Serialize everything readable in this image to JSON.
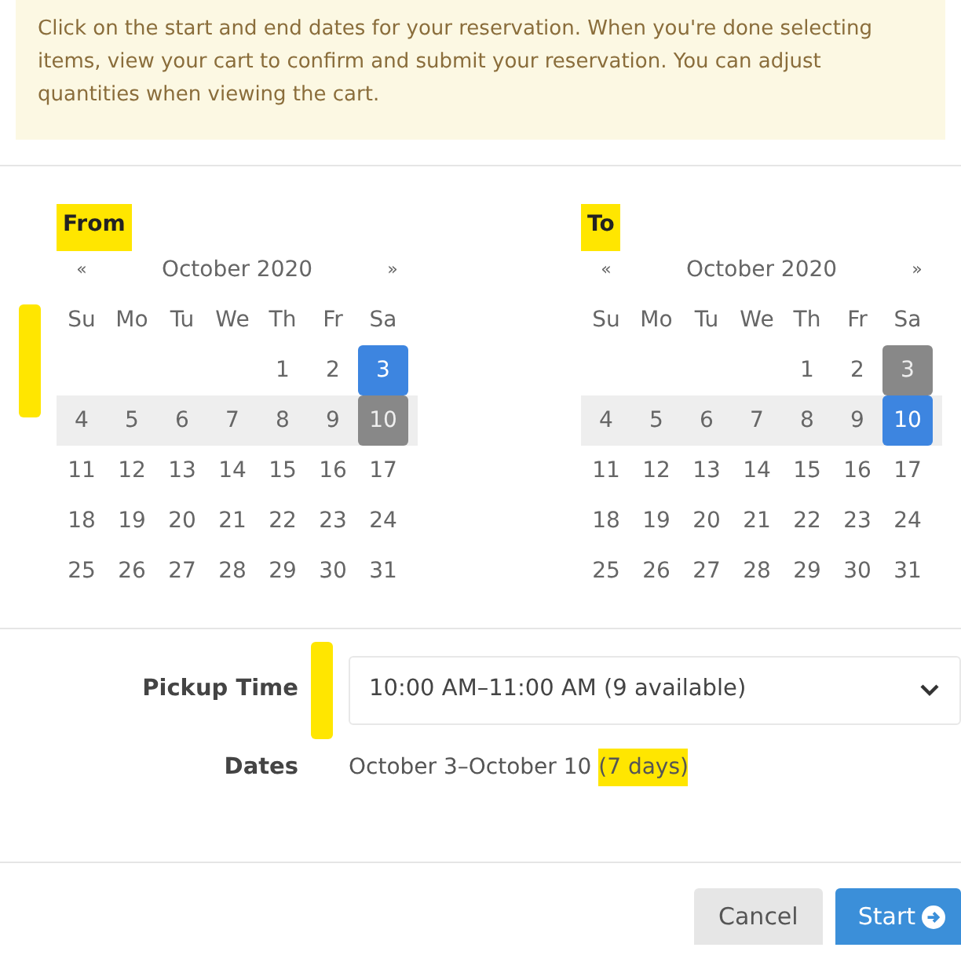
{
  "notice": "Click on the start and end dates for your reservation. When you're done selecting items, view your cart to confirm and submit your reservation. You can adjust quantities when viewing the cart.",
  "calendars": [
    {
      "label": "From",
      "highlighted": true,
      "prev": "«",
      "month": "October 2020",
      "next": "»",
      "weekdays": [
        "Su",
        "Mo",
        "Tu",
        "We",
        "Th",
        "Fr",
        "Sa"
      ],
      "weeks": [
        [
          {
            "kind": "blank"
          },
          {
            "kind": "blank"
          },
          {
            "kind": "blank"
          },
          {
            "kind": "blank"
          },
          {
            "day": "1",
            "kind": "normal"
          },
          {
            "day": "2",
            "kind": "normal"
          },
          {
            "day": "3",
            "kind": "selected"
          }
        ],
        [
          {
            "day": "4",
            "kind": "range"
          },
          {
            "day": "5",
            "kind": "range"
          },
          {
            "day": "6",
            "kind": "range"
          },
          {
            "day": "7",
            "kind": "range"
          },
          {
            "day": "8",
            "kind": "range"
          },
          {
            "day": "9",
            "kind": "range"
          },
          {
            "day": "10",
            "kind": "endpoint"
          }
        ],
        [
          {
            "day": "11",
            "kind": "normal"
          },
          {
            "day": "12",
            "kind": "normal"
          },
          {
            "day": "13",
            "kind": "normal"
          },
          {
            "day": "14",
            "kind": "normal"
          },
          {
            "day": "15",
            "kind": "normal"
          },
          {
            "day": "16",
            "kind": "normal"
          },
          {
            "day": "17",
            "kind": "normal"
          }
        ],
        [
          {
            "day": "18",
            "kind": "normal"
          },
          {
            "day": "19",
            "kind": "normal"
          },
          {
            "day": "20",
            "kind": "normal"
          },
          {
            "day": "21",
            "kind": "normal"
          },
          {
            "day": "22",
            "kind": "normal"
          },
          {
            "day": "23",
            "kind": "normal"
          },
          {
            "day": "24",
            "kind": "normal"
          }
        ],
        [
          {
            "day": "25",
            "kind": "normal"
          },
          {
            "day": "26",
            "kind": "normal"
          },
          {
            "day": "27",
            "kind": "normal"
          },
          {
            "day": "28",
            "kind": "normal"
          },
          {
            "day": "29",
            "kind": "normal"
          },
          {
            "day": "30",
            "kind": "normal"
          },
          {
            "day": "31",
            "kind": "normal"
          }
        ]
      ]
    },
    {
      "label": "To",
      "highlighted": true,
      "prev": "«",
      "month": "October 2020",
      "next": "»",
      "weekdays": [
        "Su",
        "Mo",
        "Tu",
        "We",
        "Th",
        "Fr",
        "Sa"
      ],
      "weeks": [
        [
          {
            "kind": "blank"
          },
          {
            "kind": "blank"
          },
          {
            "kind": "blank"
          },
          {
            "kind": "blank"
          },
          {
            "day": "1",
            "kind": "normal"
          },
          {
            "day": "2",
            "kind": "normal"
          },
          {
            "day": "3",
            "kind": "endpoint"
          }
        ],
        [
          {
            "day": "4",
            "kind": "range"
          },
          {
            "day": "5",
            "kind": "range"
          },
          {
            "day": "6",
            "kind": "range"
          },
          {
            "day": "7",
            "kind": "range"
          },
          {
            "day": "8",
            "kind": "range"
          },
          {
            "day": "9",
            "kind": "range"
          },
          {
            "day": "10",
            "kind": "selected"
          }
        ],
        [
          {
            "day": "11",
            "kind": "normal"
          },
          {
            "day": "12",
            "kind": "normal"
          },
          {
            "day": "13",
            "kind": "normal"
          },
          {
            "day": "14",
            "kind": "normal"
          },
          {
            "day": "15",
            "kind": "normal"
          },
          {
            "day": "16",
            "kind": "normal"
          },
          {
            "day": "17",
            "kind": "normal"
          }
        ],
        [
          {
            "day": "18",
            "kind": "normal"
          },
          {
            "day": "19",
            "kind": "normal"
          },
          {
            "day": "20",
            "kind": "normal"
          },
          {
            "day": "21",
            "kind": "normal"
          },
          {
            "day": "22",
            "kind": "normal"
          },
          {
            "day": "23",
            "kind": "normal"
          },
          {
            "day": "24",
            "kind": "normal"
          }
        ],
        [
          {
            "day": "25",
            "kind": "normal"
          },
          {
            "day": "26",
            "kind": "normal"
          },
          {
            "day": "27",
            "kind": "normal"
          },
          {
            "day": "28",
            "kind": "normal"
          },
          {
            "day": "29",
            "kind": "normal"
          },
          {
            "day": "30",
            "kind": "normal"
          },
          {
            "day": "31",
            "kind": "normal"
          }
        ]
      ]
    }
  ],
  "pickup_time": {
    "label": "Pickup Time",
    "value": "10:00 AM–11:00 AM (9 available)"
  },
  "dates": {
    "label": "Dates",
    "value": "October 3–October 10",
    "note": "(7 days)",
    "note_highlighted": true
  },
  "buttons": [
    {
      "label": "Cancel",
      "kind": "secondary"
    },
    {
      "label": "Start",
      "kind": "primary"
    }
  ]
}
